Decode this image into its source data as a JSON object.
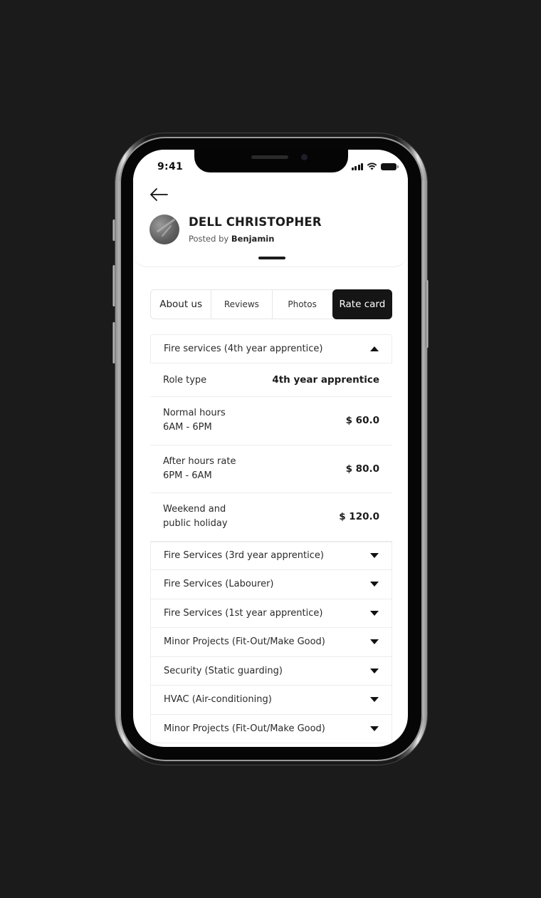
{
  "status_bar": {
    "time": "9:41",
    "icons": [
      "signal-icon",
      "wifi-icon",
      "battery-icon"
    ]
  },
  "header": {
    "back_icon": "arrow-left-icon",
    "name": "DELL CHRISTOPHER",
    "posted_by_prefix": "Posted by",
    "posted_by_name": "Benjamin"
  },
  "tabs": [
    {
      "label": "About us",
      "active": false
    },
    {
      "label": "Reviews",
      "active": false
    },
    {
      "label": "Photos",
      "active": false
    },
    {
      "label": "Rate card",
      "active": true
    }
  ],
  "rate_card": {
    "open_section": {
      "title": "Fire services (4th year apprentice)",
      "icon": "triangle-up-icon",
      "role_type_label": "Role type",
      "role_type_value": "4th year apprentice",
      "rates": [
        {
          "line1": "Normal hours",
          "line2": "6AM - 6PM",
          "value": "$ 60.0"
        },
        {
          "line1": "After hours rate",
          "line2": "6PM - 6AM",
          "value": "$ 80.0"
        },
        {
          "line1": "Weekend and",
          "line2": "public holiday",
          "value": "$ 120.0"
        }
      ]
    },
    "collapsed_sections": [
      {
        "title": "Fire Services  (3rd year apprentice)",
        "icon": "triangle-down-icon"
      },
      {
        "title": "Fire Services  (Labourer)",
        "icon": "triangle-down-icon"
      },
      {
        "title": "Fire Services  (1st year apprentice)",
        "icon": "triangle-down-icon"
      },
      {
        "title": "Minor Projects (Fit-Out/Make Good)",
        "icon": "triangle-down-icon"
      },
      {
        "title": "Security (Static guarding)",
        "icon": "triangle-down-icon"
      },
      {
        "title": "HVAC (Air-conditioning)",
        "icon": "triangle-down-icon"
      },
      {
        "title": "Minor Projects (Fit-Out/Make Good)",
        "icon": "triangle-down-icon"
      }
    ]
  }
}
